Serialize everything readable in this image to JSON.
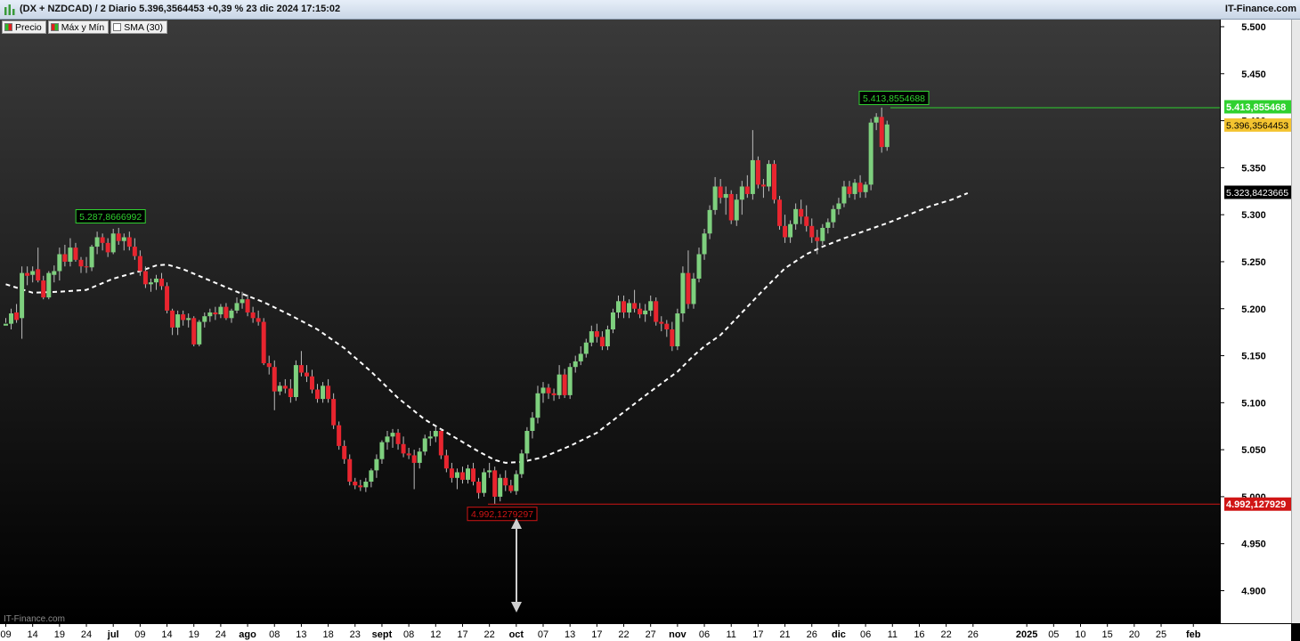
{
  "header": {
    "title": "(DX + NZDCAD) / 2 Diario 5.396,3564453 +0,39 % 23 dic 2024 17:15:02",
    "brand": "IT-Finance.com"
  },
  "legend": {
    "items": [
      {
        "label": "Precio"
      },
      {
        "label": "Máx y Mín"
      },
      {
        "label": "SMA (30)"
      }
    ]
  },
  "watermark": "IT-Finance.com",
  "colors": {
    "up": "#7ed07e",
    "down": "#e8252f",
    "sma": "#ffffff",
    "high_line": "#2fd12f",
    "low_line": "#d01515",
    "last_price_bg": "#f4c430",
    "background_top": "#3a3a3a",
    "background_bottom": "#000000"
  },
  "chart_data": {
    "type": "candlestick",
    "ylim": [
      4.87,
      5.52
    ],
    "y_ticks": [
      "5.500",
      "5.450",
      "5.400",
      "5.350",
      "5.300",
      "5.250",
      "5.200",
      "5.150",
      "5.100",
      "5.050",
      "5.000",
      "4.950",
      "4.900"
    ],
    "y_tick_values": [
      5.5,
      5.45,
      5.4,
      5.35,
      5.3,
      5.25,
      5.2,
      5.15,
      5.1,
      5.05,
      5.0,
      4.95,
      4.9
    ],
    "x_ticks": [
      {
        "i": 0,
        "label": "09"
      },
      {
        "i": 5,
        "label": "14"
      },
      {
        "i": 10,
        "label": "19"
      },
      {
        "i": 15,
        "label": "24"
      },
      {
        "i": 20,
        "label": "jul",
        "bold": true
      },
      {
        "i": 25,
        "label": "09"
      },
      {
        "i": 30,
        "label": "14"
      },
      {
        "i": 35,
        "label": "19"
      },
      {
        "i": 40,
        "label": "24"
      },
      {
        "i": 45,
        "label": "ago",
        "bold": true
      },
      {
        "i": 50,
        "label": "08"
      },
      {
        "i": 55,
        "label": "13"
      },
      {
        "i": 60,
        "label": "18"
      },
      {
        "i": 65,
        "label": "23"
      },
      {
        "i": 70,
        "label": "sept",
        "bold": true
      },
      {
        "i": 75,
        "label": "08"
      },
      {
        "i": 80,
        "label": "12"
      },
      {
        "i": 85,
        "label": "17"
      },
      {
        "i": 90,
        "label": "22"
      },
      {
        "i": 95,
        "label": "oct",
        "bold": true
      },
      {
        "i": 100,
        "label": "07"
      },
      {
        "i": 105,
        "label": "13"
      },
      {
        "i": 110,
        "label": "17"
      },
      {
        "i": 115,
        "label": "22"
      },
      {
        "i": 120,
        "label": "27"
      },
      {
        "i": 125,
        "label": "nov",
        "bold": true
      },
      {
        "i": 130,
        "label": "06"
      },
      {
        "i": 135,
        "label": "11"
      },
      {
        "i": 140,
        "label": "17"
      },
      {
        "i": 145,
        "label": "21"
      },
      {
        "i": 150,
        "label": "26"
      },
      {
        "i": 155,
        "label": "dic",
        "bold": true
      },
      {
        "i": 160,
        "label": "06"
      },
      {
        "i": 165,
        "label": "11"
      },
      {
        "i": 170,
        "label": "16"
      },
      {
        "i": 175,
        "label": "22"
      },
      {
        "i": 180,
        "label": "26"
      },
      {
        "i": 190,
        "label": "2025",
        "bold": true
      },
      {
        "i": 195,
        "label": "05"
      },
      {
        "i": 200,
        "label": "10"
      },
      {
        "i": 205,
        "label": "15"
      },
      {
        "i": 210,
        "label": "20"
      },
      {
        "i": 215,
        "label": "25"
      },
      {
        "i": 221,
        "label": "feb",
        "bold": true
      }
    ],
    "total_slots": 230,
    "candles": [
      [
        5.182,
        5.19,
        5.185,
        5.184
      ],
      [
        5.184,
        5.2,
        5.178,
        5.195
      ],
      [
        5.196,
        5.205,
        5.185,
        5.188
      ],
      [
        5.19,
        5.245,
        5.168,
        5.238
      ],
      [
        5.238,
        5.245,
        5.225,
        5.235
      ],
      [
        5.236,
        5.245,
        5.228,
        5.24
      ],
      [
        5.242,
        5.265,
        5.228,
        5.23
      ],
      [
        5.23,
        5.235,
        5.21,
        5.212
      ],
      [
        5.212,
        5.24,
        5.21,
        5.238
      ],
      [
        5.236,
        5.246,
        5.228,
        5.24
      ],
      [
        5.24,
        5.265,
        5.23,
        5.258
      ],
      [
        5.258,
        5.268,
        5.245,
        5.25
      ],
      [
        5.25,
        5.275,
        5.245,
        5.265
      ],
      [
        5.265,
        5.27,
        5.25,
        5.252
      ],
      [
        5.252,
        5.255,
        5.238,
        5.245
      ],
      [
        5.245,
        5.255,
        5.238,
        5.244
      ],
      [
        5.244,
        5.268,
        5.24,
        5.266
      ],
      [
        5.266,
        5.282,
        5.258,
        5.276
      ],
      [
        5.276,
        5.28,
        5.262,
        5.27
      ],
      [
        5.27,
        5.275,
        5.255,
        5.26
      ],
      [
        5.26,
        5.285,
        5.258,
        5.28
      ],
      [
        5.28,
        5.286,
        5.268,
        5.272
      ],
      [
        5.272,
        5.28,
        5.262,
        5.276
      ],
      [
        5.276,
        5.282,
        5.262,
        5.266
      ],
      [
        5.266,
        5.275,
        5.252,
        5.256
      ],
      [
        5.256,
        5.262,
        5.235,
        5.24
      ],
      [
        5.24,
        5.245,
        5.222,
        5.226
      ],
      [
        5.226,
        5.232,
        5.218,
        5.228
      ],
      [
        5.228,
        5.236,
        5.22,
        5.232
      ],
      [
        5.232,
        5.238,
        5.22,
        5.224
      ],
      [
        5.224,
        5.228,
        5.195,
        5.198
      ],
      [
        5.198,
        5.2,
        5.172,
        5.18
      ],
      [
        5.18,
        5.198,
        5.172,
        5.194
      ],
      [
        5.194,
        5.198,
        5.182,
        5.188
      ],
      [
        5.188,
        5.195,
        5.18,
        5.19
      ],
      [
        5.19,
        5.192,
        5.16,
        5.162
      ],
      [
        5.162,
        5.188,
        5.16,
        5.186
      ],
      [
        5.186,
        5.196,
        5.18,
        5.192
      ],
      [
        5.192,
        5.2,
        5.186,
        5.196
      ],
      [
        5.196,
        5.202,
        5.188,
        5.194
      ],
      [
        5.194,
        5.205,
        5.19,
        5.202
      ],
      [
        5.202,
        5.206,
        5.188,
        5.19
      ],
      [
        5.19,
        5.2,
        5.185,
        5.198
      ],
      [
        5.198,
        5.212,
        5.195,
        5.206
      ],
      [
        5.206,
        5.218,
        5.2,
        5.21
      ],
      [
        5.21,
        5.215,
        5.192,
        5.196
      ],
      [
        5.196,
        5.202,
        5.185,
        5.19
      ],
      [
        5.19,
        5.198,
        5.182,
        5.186
      ],
      [
        5.186,
        5.19,
        5.14,
        5.142
      ],
      [
        5.142,
        5.15,
        5.13,
        5.138
      ],
      [
        5.138,
        5.145,
        5.092,
        5.112
      ],
      [
        5.112,
        5.122,
        5.108,
        5.118
      ],
      [
        5.118,
        5.125,
        5.11,
        5.115
      ],
      [
        5.115,
        5.125,
        5.1,
        5.106
      ],
      [
        5.106,
        5.145,
        5.102,
        5.14
      ],
      [
        5.14,
        5.155,
        5.128,
        5.132
      ],
      [
        5.132,
        5.14,
        5.122,
        5.128
      ],
      [
        5.128,
        5.135,
        5.11,
        5.114
      ],
      [
        5.114,
        5.12,
        5.1,
        5.104
      ],
      [
        5.104,
        5.122,
        5.1,
        5.118
      ],
      [
        5.118,
        5.125,
        5.1,
        5.104
      ],
      [
        5.104,
        5.11,
        5.072,
        5.076
      ],
      [
        5.076,
        5.08,
        5.05,
        5.054
      ],
      [
        5.054,
        5.06,
        5.035,
        5.04
      ],
      [
        5.04,
        5.045,
        5.012,
        5.016
      ],
      [
        5.016,
        5.02,
        5.008,
        5.012
      ],
      [
        5.012,
        5.018,
        5.006,
        5.01
      ],
      [
        5.01,
        5.02,
        5.005,
        5.016
      ],
      [
        5.016,
        5.03,
        5.01,
        5.028
      ],
      [
        5.028,
        5.045,
        5.02,
        5.04
      ],
      [
        5.04,
        5.06,
        5.035,
        5.058
      ],
      [
        5.058,
        5.07,
        5.05,
        5.064
      ],
      [
        5.064,
        5.072,
        5.052,
        5.068
      ],
      [
        5.068,
        5.072,
        5.05,
        5.056
      ],
      [
        5.056,
        5.064,
        5.042,
        5.046
      ],
      [
        5.046,
        5.052,
        5.04,
        5.044
      ],
      [
        5.044,
        5.05,
        5.008,
        5.036
      ],
      [
        5.036,
        5.052,
        5.03,
        5.048
      ],
      [
        5.048,
        5.066,
        5.044,
        5.062
      ],
      [
        5.062,
        5.07,
        5.054,
        5.064
      ],
      [
        5.064,
        5.075,
        5.058,
        5.07
      ],
      [
        5.07,
        5.072,
        5.04,
        5.044
      ],
      [
        5.044,
        5.05,
        5.026,
        5.03
      ],
      [
        5.03,
        5.036,
        5.015,
        5.02
      ],
      [
        5.02,
        5.03,
        5.008,
        5.026
      ],
      [
        5.026,
        5.032,
        5.014,
        5.018
      ],
      [
        5.018,
        5.034,
        5.014,
        5.03
      ],
      [
        5.03,
        5.036,
        5.012,
        5.016
      ],
      [
        5.016,
        5.02,
        4.998,
        5.004
      ],
      [
        5.004,
        5.03,
        5.0,
        5.026
      ],
      [
        5.026,
        5.036,
        5.02,
        5.028
      ],
      [
        5.028,
        5.032,
        4.992,
        5.0
      ],
      [
        5.0,
        5.024,
        4.995,
        5.02
      ],
      [
        5.02,
        5.028,
        5.006,
        5.012
      ],
      [
        5.012,
        5.018,
        5.004,
        5.006
      ],
      [
        5.006,
        5.028,
        5.002,
        5.024
      ],
      [
        5.024,
        5.05,
        5.02,
        5.046
      ],
      [
        5.046,
        5.074,
        5.04,
        5.07
      ],
      [
        5.07,
        5.09,
        5.062,
        5.084
      ],
      [
        5.084,
        5.118,
        5.078,
        5.11
      ],
      [
        5.11,
        5.122,
        5.1,
        5.116
      ],
      [
        5.116,
        5.12,
        5.104,
        5.11
      ],
      [
        5.11,
        5.115,
        5.102,
        5.108
      ],
      [
        5.108,
        5.14,
        5.104,
        5.13
      ],
      [
        5.13,
        5.136,
        5.105,
        5.108
      ],
      [
        5.108,
        5.142,
        5.104,
        5.138
      ],
      [
        5.138,
        5.15,
        5.132,
        5.144
      ],
      [
        5.144,
        5.16,
        5.14,
        5.152
      ],
      [
        5.152,
        5.168,
        5.148,
        5.164
      ],
      [
        5.164,
        5.182,
        5.16,
        5.176
      ],
      [
        5.176,
        5.184,
        5.164,
        5.17
      ],
      [
        5.17,
        5.176,
        5.156,
        5.16
      ],
      [
        5.16,
        5.182,
        5.156,
        5.178
      ],
      [
        5.178,
        5.2,
        5.174,
        5.196
      ],
      [
        5.196,
        5.214,
        5.19,
        5.208
      ],
      [
        5.208,
        5.214,
        5.19,
        5.196
      ],
      [
        5.196,
        5.21,
        5.19,
        5.206
      ],
      [
        5.206,
        5.22,
        5.196,
        5.2
      ],
      [
        5.2,
        5.206,
        5.19,
        5.194
      ],
      [
        5.194,
        5.205,
        5.186,
        5.198
      ],
      [
        5.198,
        5.214,
        5.192,
        5.208
      ],
      [
        5.208,
        5.212,
        5.182,
        5.186
      ],
      [
        5.186,
        5.192,
        5.176,
        5.184
      ],
      [
        5.184,
        5.188,
        5.17,
        5.178
      ],
      [
        5.178,
        5.186,
        5.155,
        5.16
      ],
      [
        5.16,
        5.2,
        5.156,
        5.195
      ],
      [
        5.195,
        5.245,
        5.186,
        5.238
      ],
      [
        5.238,
        5.262,
        5.2,
        5.205
      ],
      [
        5.205,
        5.238,
        5.2,
        5.232
      ],
      [
        5.232,
        5.265,
        5.228,
        5.258
      ],
      [
        5.258,
        5.285,
        5.252,
        5.28
      ],
      [
        5.28,
        5.31,
        5.274,
        5.305
      ],
      [
        5.305,
        5.34,
        5.3,
        5.33
      ],
      [
        5.33,
        5.338,
        5.312,
        5.318
      ],
      [
        5.318,
        5.33,
        5.3,
        5.322
      ],
      [
        5.322,
        5.326,
        5.29,
        5.294
      ],
      [
        5.294,
        5.322,
        5.288,
        5.316
      ],
      [
        5.316,
        5.336,
        5.3,
        5.33
      ],
      [
        5.33,
        5.342,
        5.318,
        5.322
      ],
      [
        5.322,
        5.39,
        5.316,
        5.358
      ],
      [
        5.358,
        5.362,
        5.328,
        5.332
      ],
      [
        5.332,
        5.338,
        5.318,
        5.33
      ],
      [
        5.33,
        5.358,
        5.325,
        5.354
      ],
      [
        5.354,
        5.358,
        5.312,
        5.316
      ],
      [
        5.316,
        5.32,
        5.284,
        5.288
      ],
      [
        5.288,
        5.3,
        5.27,
        5.276
      ],
      [
        5.276,
        5.294,
        5.27,
        5.29
      ],
      [
        5.29,
        5.312,
        5.284,
        5.306
      ],
      [
        5.306,
        5.316,
        5.29,
        5.298
      ],
      [
        5.298,
        5.31,
        5.282,
        5.288
      ],
      [
        5.288,
        5.296,
        5.27,
        5.276
      ],
      [
        5.276,
        5.284,
        5.258,
        5.272
      ],
      [
        5.272,
        5.29,
        5.268,
        5.286
      ],
      [
        5.286,
        5.296,
        5.28,
        5.292
      ],
      [
        5.292,
        5.31,
        5.286,
        5.306
      ],
      [
        5.306,
        5.318,
        5.3,
        5.312
      ],
      [
        5.312,
        5.336,
        5.308,
        5.33
      ],
      [
        5.33,
        5.336,
        5.318,
        5.322
      ],
      [
        5.322,
        5.338,
        5.316,
        5.334
      ],
      [
        5.334,
        5.342,
        5.318,
        5.324
      ],
      [
        5.324,
        5.335,
        5.318,
        5.332
      ],
      [
        5.332,
        5.402,
        5.326,
        5.398
      ],
      [
        5.398,
        5.408,
        5.39,
        5.404
      ],
      [
        5.404,
        5.414,
        5.366,
        5.372
      ],
      [
        5.372,
        5.4,
        5.368,
        5.396
      ]
    ],
    "sma": [
      [
        0,
        5.226
      ],
      [
        5,
        5.217
      ],
      [
        10,
        5.218
      ],
      [
        15,
        5.22
      ],
      [
        20,
        5.232
      ],
      [
        25,
        5.24
      ],
      [
        28,
        5.246
      ],
      [
        30,
        5.247
      ],
      [
        33,
        5.242
      ],
      [
        38,
        5.23
      ],
      [
        43,
        5.218
      ],
      [
        48,
        5.207
      ],
      [
        53,
        5.193
      ],
      [
        58,
        5.178
      ],
      [
        63,
        5.158
      ],
      [
        68,
        5.133
      ],
      [
        73,
        5.105
      ],
      [
        78,
        5.082
      ],
      [
        83,
        5.065
      ],
      [
        88,
        5.048
      ],
      [
        91,
        5.039
      ],
      [
        93,
        5.036
      ],
      [
        96,
        5.037
      ],
      [
        100,
        5.042
      ],
      [
        105,
        5.054
      ],
      [
        110,
        5.068
      ],
      [
        115,
        5.09
      ],
      [
        120,
        5.112
      ],
      [
        125,
        5.133
      ],
      [
        128,
        5.15
      ],
      [
        130,
        5.16
      ],
      [
        133,
        5.172
      ],
      [
        137,
        5.196
      ],
      [
        141,
        5.22
      ],
      [
        145,
        5.243
      ],
      [
        149,
        5.258
      ],
      [
        152,
        5.266
      ],
      [
        156,
        5.275
      ],
      [
        160,
        5.283
      ],
      [
        164,
        5.291
      ],
      [
        168,
        5.3
      ],
      [
        172,
        5.309
      ],
      [
        176,
        5.316
      ],
      [
        179,
        5.323
      ]
    ],
    "high_label": "5.287,8666992",
    "high_label_at": 20,
    "high_label_value": 5.2879,
    "max_value": 5.4138554688,
    "max_label": "5.413,8554688",
    "max_axis_label": "5.413,855468",
    "min_value": 4.9921279297,
    "min_label": "4.992,1279297",
    "min_axis_label": "4.992,127929",
    "last_value": 5.3963564453,
    "last_label": "5.396,3564453",
    "sma_last_value": 5.3238423665,
    "sma_last_label": "5.323,8423665"
  }
}
